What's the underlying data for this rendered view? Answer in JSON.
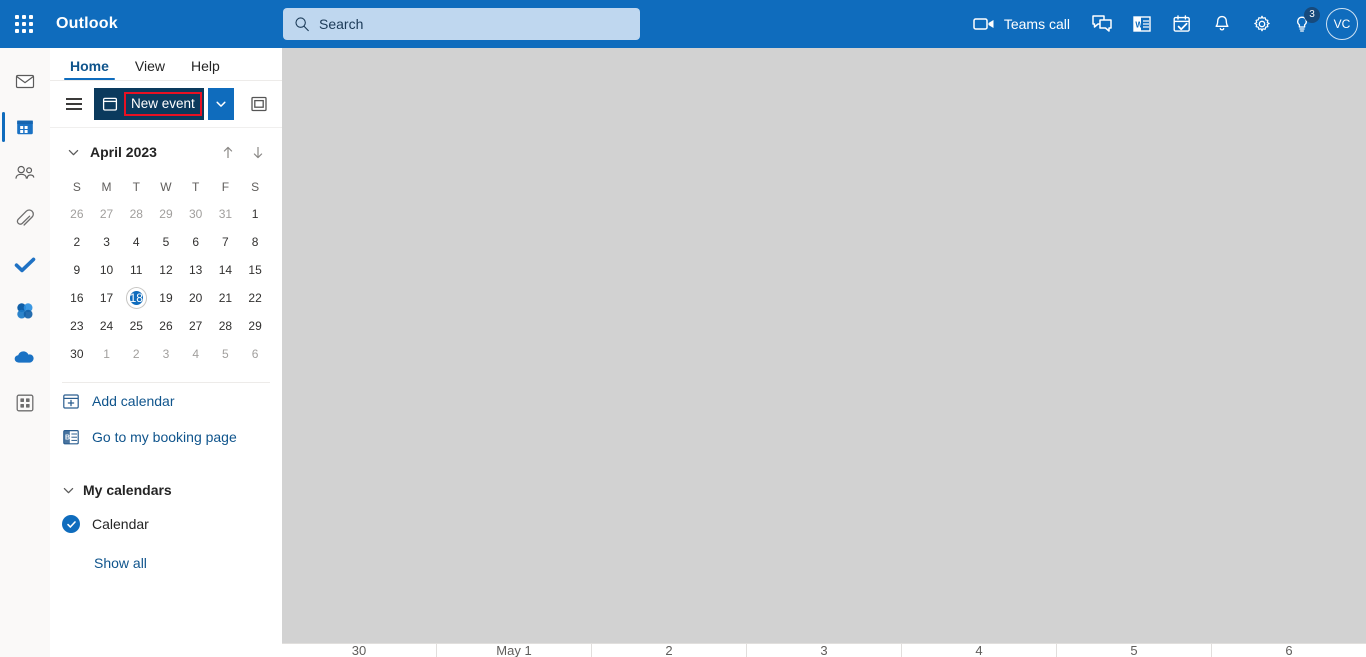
{
  "topbar": {
    "app_waffle": "app-launcher",
    "brand": "Outlook",
    "search": {
      "placeholder": "Search",
      "value": ""
    },
    "teams_call_label": "Teams call",
    "actions": [
      {
        "name": "teams-call",
        "icon": "video-camera-icon",
        "label": "Teams call"
      },
      {
        "name": "chat",
        "icon": "chat-icon",
        "label": ""
      },
      {
        "name": "office-apps",
        "icon": "office-contact-card-icon",
        "label": ""
      },
      {
        "name": "todo",
        "icon": "calendar-check-icon",
        "label": ""
      },
      {
        "name": "notifications",
        "icon": "bell-icon",
        "label": ""
      },
      {
        "name": "settings",
        "icon": "gear-icon",
        "label": ""
      },
      {
        "name": "help-tips",
        "icon": "lightbulb-icon",
        "label": "",
        "badge": "3"
      }
    ],
    "avatar_initials": "VC",
    "accent_color": "#0f6cbd"
  },
  "rail": {
    "items": [
      {
        "name": "mail",
        "icon": "envelope-icon",
        "selected": false
      },
      {
        "name": "calendar",
        "icon": "calendar-icon",
        "selected": true
      },
      {
        "name": "people",
        "icon": "people-icon",
        "selected": false
      },
      {
        "name": "files",
        "icon": "paperclip-icon",
        "selected": false
      },
      {
        "name": "to-do",
        "icon": "checkmark-icon",
        "selected": false
      },
      {
        "name": "viva-engage",
        "icon": "viva-icon",
        "selected": false
      },
      {
        "name": "onedrive",
        "icon": "cloud-icon",
        "selected": false
      },
      {
        "name": "more-apps",
        "icon": "apps-grid-icon",
        "selected": false
      }
    ]
  },
  "sidebar": {
    "tabs": [
      {
        "label": "Home",
        "active": true
      },
      {
        "label": "View",
        "active": false
      },
      {
        "label": "Help",
        "active": false
      }
    ],
    "ribbon": {
      "menu_label": "",
      "new_event_label": "New event",
      "new_event_caret": "chevron-down-icon",
      "pane_toggle": "reading-pane-icon",
      "highlight_color": "#e81123"
    },
    "minicalendar": {
      "title": "April 2023",
      "collapse_icon": "chevron-down-icon",
      "prev_label": "previous-month",
      "next_label": "next-month",
      "weekdays": [
        "S",
        "M",
        "T",
        "W",
        "T",
        "F",
        "S"
      ],
      "weeks": [
        [
          {
            "d": "26",
            "other": true
          },
          {
            "d": "27",
            "other": true
          },
          {
            "d": "28",
            "other": true
          },
          {
            "d": "29",
            "other": true
          },
          {
            "d": "30",
            "other": true
          },
          {
            "d": "31",
            "other": true
          },
          {
            "d": "1",
            "other": false
          }
        ],
        [
          {
            "d": "2"
          },
          {
            "d": "3"
          },
          {
            "d": "4"
          },
          {
            "d": "5"
          },
          {
            "d": "6"
          },
          {
            "d": "7"
          },
          {
            "d": "8"
          }
        ],
        [
          {
            "d": "9"
          },
          {
            "d": "10"
          },
          {
            "d": "11"
          },
          {
            "d": "12"
          },
          {
            "d": "13"
          },
          {
            "d": "14"
          },
          {
            "d": "15"
          }
        ],
        [
          {
            "d": "16"
          },
          {
            "d": "17"
          },
          {
            "d": "18",
            "selected": true
          },
          {
            "d": "19"
          },
          {
            "d": "20"
          },
          {
            "d": "21"
          },
          {
            "d": "22"
          }
        ],
        [
          {
            "d": "23"
          },
          {
            "d": "24"
          },
          {
            "d": "25"
          },
          {
            "d": "26"
          },
          {
            "d": "27"
          },
          {
            "d": "28"
          },
          {
            "d": "29"
          }
        ],
        [
          {
            "d": "30"
          },
          {
            "d": "1",
            "other": true
          },
          {
            "d": "2",
            "other": true
          },
          {
            "d": "3",
            "other": true
          },
          {
            "d": "4",
            "other": true
          },
          {
            "d": "5",
            "other": true
          },
          {
            "d": "6",
            "other": true
          }
        ]
      ]
    },
    "links": [
      {
        "label": "Add calendar",
        "icon": "add-calendar-icon"
      },
      {
        "label": "Go to my booking page",
        "icon": "bookings-icon"
      }
    ],
    "my_calendars": {
      "heading": "My calendars",
      "collapse_icon": "chevron-down-icon",
      "items": [
        {
          "label": "Calendar",
          "checked": true,
          "color": "#0f6cbd"
        }
      ],
      "show_all_label": "Show all"
    }
  },
  "main": {
    "background_color": "#d2d2d2",
    "week_header": [
      "30",
      "May 1",
      "2",
      "3",
      "4",
      "5",
      "6"
    ]
  }
}
